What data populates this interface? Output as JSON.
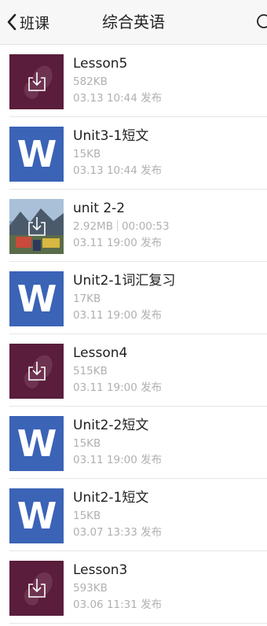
{
  "nav": {
    "back_label": "班课",
    "title": "综合英语"
  },
  "colors": {
    "word_blue": "#3b63b6",
    "media_maroon": "#5a1d3b",
    "meta_gray": "#b0b0b0"
  },
  "files": [
    {
      "name": "Lesson5",
      "size": "582KB",
      "duration": "",
      "date": "03.13 10:44 发布",
      "icon": "download-icon"
    },
    {
      "name": "Unit3-1短文",
      "size": "15KB",
      "duration": "",
      "date": "03.13 10:44 发布",
      "icon": "word-icon"
    },
    {
      "name": "unit 2-2",
      "size": "2.92MB",
      "duration": "00:00:53",
      "date": "03.11 19:00 发布",
      "icon": "video-download-icon"
    },
    {
      "name": "Unit2-1词汇复习",
      "size": "17KB",
      "duration": "",
      "date": "03.11 19:00 发布",
      "icon": "word-icon"
    },
    {
      "name": "Lesson4",
      "size": "515KB",
      "duration": "",
      "date": "03.11 19:00 发布",
      "icon": "download-icon"
    },
    {
      "name": "Unit2-2短文",
      "size": "15KB",
      "duration": "",
      "date": "03.11 19:00 发布",
      "icon": "word-icon"
    },
    {
      "name": "Unit2-1短文",
      "size": "15KB",
      "duration": "",
      "date": "03.07 13:33 发布",
      "icon": "word-icon"
    },
    {
      "name": "Lesson3",
      "size": "593KB",
      "duration": "",
      "date": "03.06 11:31 发布",
      "icon": "download-icon"
    }
  ]
}
